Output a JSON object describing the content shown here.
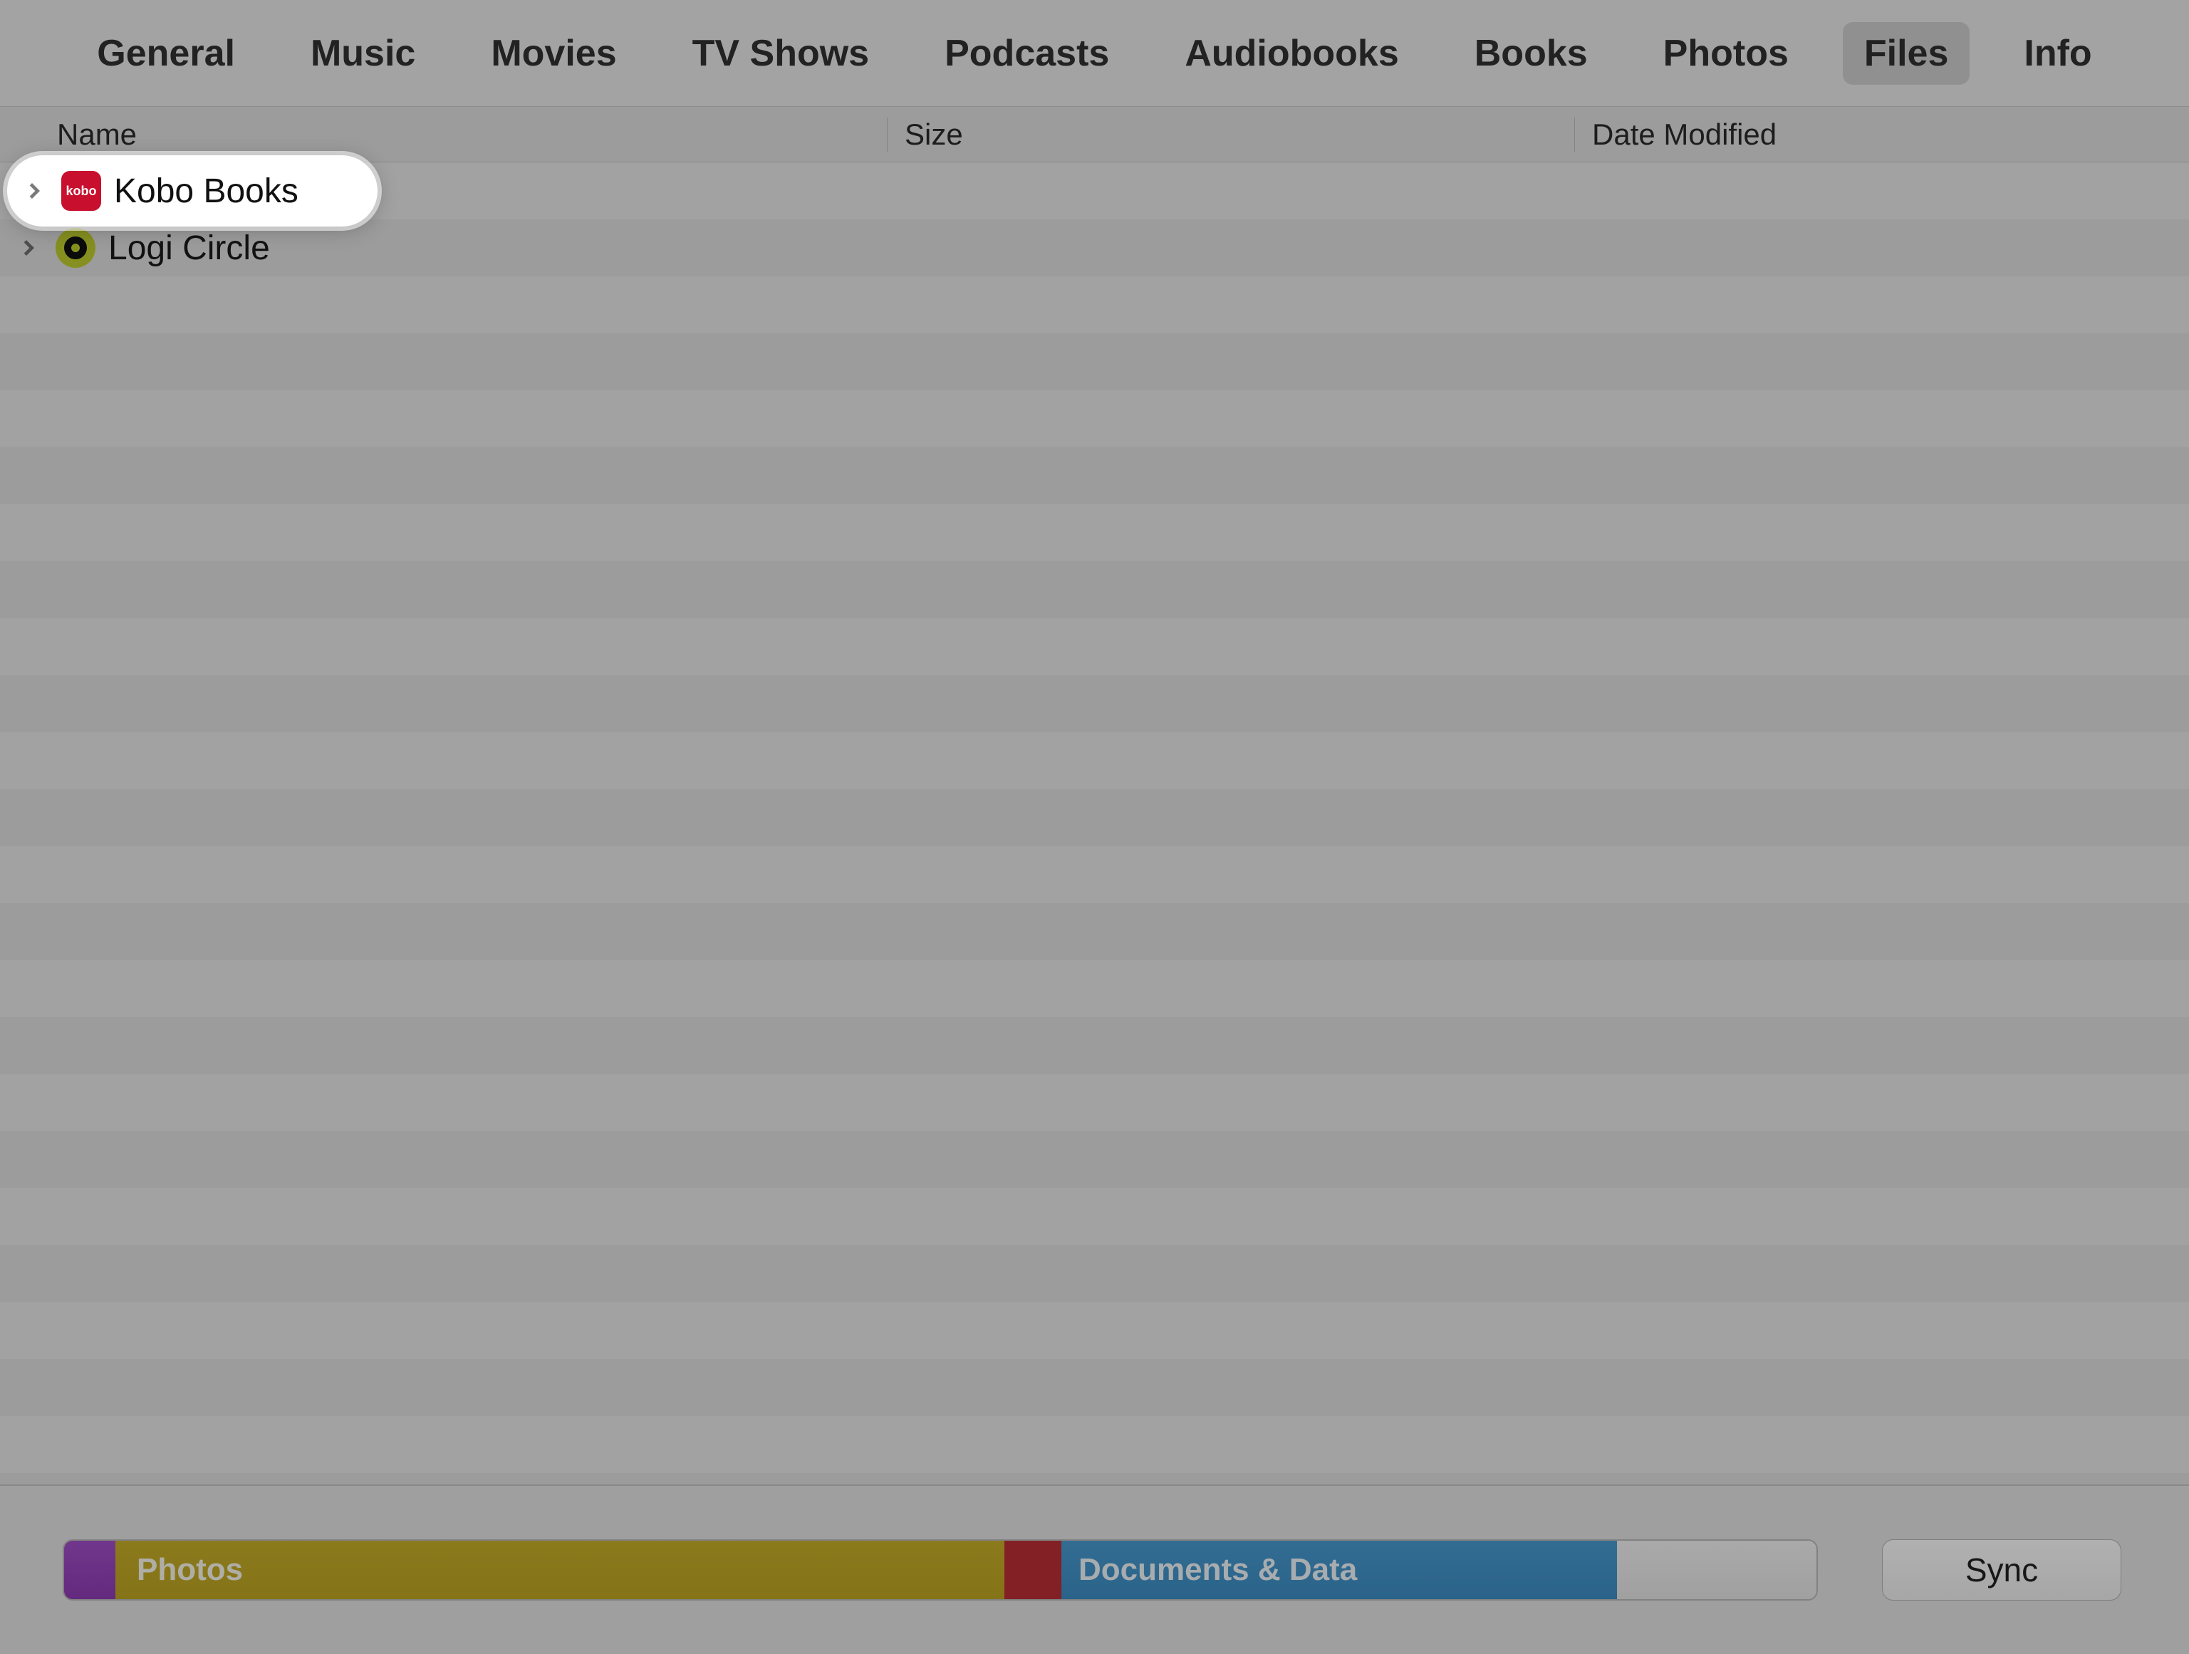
{
  "tabs": {
    "items": [
      {
        "label": "General"
      },
      {
        "label": "Music"
      },
      {
        "label": "Movies"
      },
      {
        "label": "TV Shows"
      },
      {
        "label": "Podcasts"
      },
      {
        "label": "Audiobooks"
      },
      {
        "label": "Books"
      },
      {
        "label": "Photos"
      },
      {
        "label": "Files"
      },
      {
        "label": "Info"
      }
    ],
    "active_index": 8
  },
  "columns": {
    "name": "Name",
    "size": "Size",
    "date": "Date Modified"
  },
  "files": [
    {
      "name": "Kobo Books",
      "icon": "kobo"
    },
    {
      "name": "Logi Circle",
      "icon": "logi"
    }
  ],
  "highlighted_file_index": 0,
  "storage": {
    "segments": {
      "photos": "Photos",
      "docs": "Documents & Data"
    }
  },
  "sync_label": "Sync"
}
